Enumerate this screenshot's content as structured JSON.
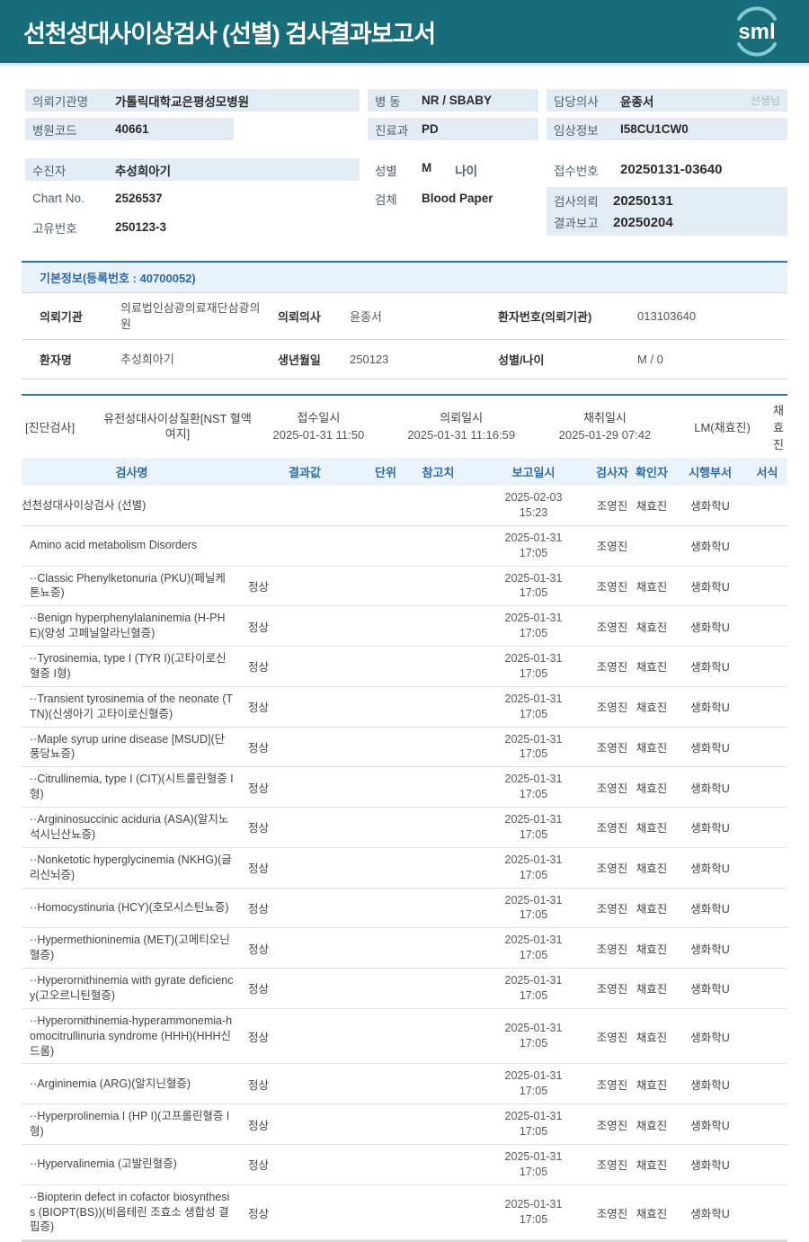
{
  "header": {
    "title": "선천성대사이상검사 (선별) 검사결과보고서",
    "logo_text": "sml"
  },
  "info": {
    "org_label": "의뢰기관명",
    "org": "가톨릭대학교은평성모병원",
    "hosp_code_label": "병원코드",
    "hosp_code": "40661",
    "patient_label": "수진자",
    "patient": "추성희아기",
    "chart_label": "Chart No.",
    "chart": "2526537",
    "uid_label": "고유번호",
    "uid": "250123-3",
    "ward_label": "병  동",
    "ward": "NR / SBABY",
    "dept_label": "진료과",
    "dept": "PD",
    "sex_label": "성별",
    "sex": "M",
    "age_label": "나이",
    "age": "",
    "specimen_label": "검체",
    "specimen": "Blood Paper",
    "doctor_label": "담당의사",
    "doctor": "윤종서",
    "doctor_suffix": "선생님",
    "clinical_label": "임상정보",
    "clinical": "I58CU1CW0",
    "receipt_label": "접수번호",
    "receipt_no": "20250131-03640",
    "request_label": "검사의뢰",
    "request_date": "20250131",
    "report_label": "결과보고",
    "report_date": "20250204"
  },
  "basic": {
    "title": "기본정보(등록번호 : 40700052)",
    "rows": [
      {
        "l1": "의뢰기관",
        "v1": "의료법인삼광의료재단삼광의원",
        "l2": "의뢰의사",
        "v2": "윤종서",
        "l3": "환자번호(의뢰기관)",
        "v3": "013103640"
      },
      {
        "l1": "환자명",
        "v1": "추성희아기",
        "l2": "생년월일",
        "v2": "250123",
        "l3": "성별/나이",
        "v3": "M / 0"
      }
    ]
  },
  "diag": {
    "tag": "[진단검사]",
    "test_name": "유전성대사이상질환[NST 혈액여지]",
    "receipt_label": "접수일시",
    "receipt": "2025-01-31 11:50",
    "request_label": "의뢰일시",
    "request": "2025-01-31 11:16:59",
    "collect_label": "채취일시",
    "collect": "2025-01-29 07:42",
    "lm": "LM(채효진)",
    "collector": "채효진"
  },
  "table": {
    "headers": [
      "검사명",
      "결과값",
      "단위",
      "참고치",
      "보고일시",
      "검사자",
      "확인자",
      "시행부서",
      "서식"
    ],
    "rows": [
      {
        "name": "선천성대사이상검사 (선별)",
        "indent": 0,
        "result": "",
        "unit": "",
        "ref": "",
        "date": "2025-02-03",
        "time": "15:23",
        "tester": "조영진",
        "confirmer": "채효진",
        "dept": "생화학U",
        "form": ""
      },
      {
        "name": "Amino acid metabolism Disorders",
        "indent": 1,
        "result": "",
        "unit": "",
        "ref": "",
        "date": "2025-01-31",
        "time": "17:05",
        "tester": "조영진",
        "confirmer": "",
        "dept": "생화학U",
        "form": ""
      },
      {
        "name": "··Classic Phenylketonuria (PKU)(페닐케톤뇨증)",
        "indent": 1,
        "result": "정상",
        "unit": "",
        "ref": "",
        "date": "2025-01-31",
        "time": "17:05",
        "tester": "조영진",
        "confirmer": "채효진",
        "dept": "생화학U",
        "form": ""
      },
      {
        "name": "··Benign hyperphenylalaninemia (H-PHE)(양성 고페닐알라닌혈증)",
        "indent": 1,
        "result": "정상",
        "unit": "",
        "ref": "",
        "date": "2025-01-31",
        "time": "17:05",
        "tester": "조영진",
        "confirmer": "채효진",
        "dept": "생화학U",
        "form": ""
      },
      {
        "name": "··Tyrosinemia, type I (TYR I)(고타이로신혈증 I형)",
        "indent": 1,
        "result": "정상",
        "unit": "",
        "ref": "",
        "date": "2025-01-31",
        "time": "17:05",
        "tester": "조영진",
        "confirmer": "채효진",
        "dept": "생화학U",
        "form": ""
      },
      {
        "name": "··Transient tyrosinemia of the neonate (TTN)(신생아기 고타이로신혈증)",
        "indent": 1,
        "result": "정상",
        "unit": "",
        "ref": "",
        "date": "2025-01-31",
        "time": "17:05",
        "tester": "조영진",
        "confirmer": "채효진",
        "dept": "생화학U",
        "form": ""
      },
      {
        "name": "··Maple syrup urine disease [MSUD](단풍당뇨증)",
        "indent": 1,
        "result": "정상",
        "unit": "",
        "ref": "",
        "date": "2025-01-31",
        "time": "17:05",
        "tester": "조영진",
        "confirmer": "채효진",
        "dept": "생화학U",
        "form": ""
      },
      {
        "name": "··Citrullinemia, type I (CIT)(시트룰린혈증 I형)",
        "indent": 1,
        "result": "정상",
        "unit": "",
        "ref": "",
        "date": "2025-01-31",
        "time": "17:05",
        "tester": "조영진",
        "confirmer": "채효진",
        "dept": "생화학U",
        "form": ""
      },
      {
        "name": "··Argininosuccinic aciduria (ASA)(알지노석시닌산뇨증)",
        "indent": 1,
        "result": "정상",
        "unit": "",
        "ref": "",
        "date": "2025-01-31",
        "time": "17:05",
        "tester": "조영진",
        "confirmer": "채효진",
        "dept": "생화학U",
        "form": ""
      },
      {
        "name": "··Nonketotic hyperglycinemia (NKHG)(글리신뇌증)",
        "indent": 1,
        "result": "정상",
        "unit": "",
        "ref": "",
        "date": "2025-01-31",
        "time": "17:05",
        "tester": "조영진",
        "confirmer": "채효진",
        "dept": "생화학U",
        "form": ""
      },
      {
        "name": "··Homocystinuria (HCY)(호모시스틴뇨증)",
        "indent": 1,
        "result": "정상",
        "unit": "",
        "ref": "",
        "date": "2025-01-31",
        "time": "17:05",
        "tester": "조영진",
        "confirmer": "채효진",
        "dept": "생화학U",
        "form": ""
      },
      {
        "name": "··Hypermethioninemia (MET)(고메티오닌혈증)",
        "indent": 1,
        "result": "정상",
        "unit": "",
        "ref": "",
        "date": "2025-01-31",
        "time": "17:05",
        "tester": "조영진",
        "confirmer": "채효진",
        "dept": "생화학U",
        "form": ""
      },
      {
        "name": "··Hyperornithinemia with gyrate deficiency(고오르니틴혈증)",
        "indent": 1,
        "result": "정상",
        "unit": "",
        "ref": "",
        "date": "2025-01-31",
        "time": "17:05",
        "tester": "조영진",
        "confirmer": "채효진",
        "dept": "생화학U",
        "form": ""
      },
      {
        "name": "··Hyperornithinemia-hyperammonemia-homocitrullinuria syndrome (HHH)(HHH신드롬)",
        "indent": 1,
        "result": "정상",
        "unit": "",
        "ref": "",
        "date": "2025-01-31",
        "time": "17:05",
        "tester": "조영진",
        "confirmer": "채효진",
        "dept": "생화학U",
        "form": ""
      },
      {
        "name": "··Argininemia (ARG)(알지닌혈증)",
        "indent": 1,
        "result": "정상",
        "unit": "",
        "ref": "",
        "date": "2025-01-31",
        "time": "17:05",
        "tester": "조영진",
        "confirmer": "채효진",
        "dept": "생화학U",
        "form": ""
      },
      {
        "name": "··Hyperprolinemia I (HP I)(고프롤린혈증 I형)",
        "indent": 1,
        "result": "정상",
        "unit": "",
        "ref": "",
        "date": "2025-01-31",
        "time": "17:05",
        "tester": "조영진",
        "confirmer": "채효진",
        "dept": "생화학U",
        "form": ""
      },
      {
        "name": "··Hypervalinemia (고발린혈증)",
        "indent": 1,
        "result": "정상",
        "unit": "",
        "ref": "",
        "date": "2025-01-31",
        "time": "17:05",
        "tester": "조영진",
        "confirmer": "채효진",
        "dept": "생화학U",
        "form": ""
      },
      {
        "name": "··Biopterin defect in cofactor biosynthesis (BIOPT(BS))(비옵테린 조효소 생합성 결핍증)",
        "indent": 1,
        "result": "정상",
        "unit": "",
        "ref": "",
        "date": "2025-01-31",
        "time": "17:05",
        "tester": "조영진",
        "confirmer": "채효진",
        "dept": "생화학U",
        "form": ""
      }
    ]
  },
  "colors": {
    "banner_teal": "#176d7a",
    "chip_blue": "#e3ecf4",
    "section_border_blue": "#2e74b5",
    "header_text_blue": "#2e6da4"
  }
}
